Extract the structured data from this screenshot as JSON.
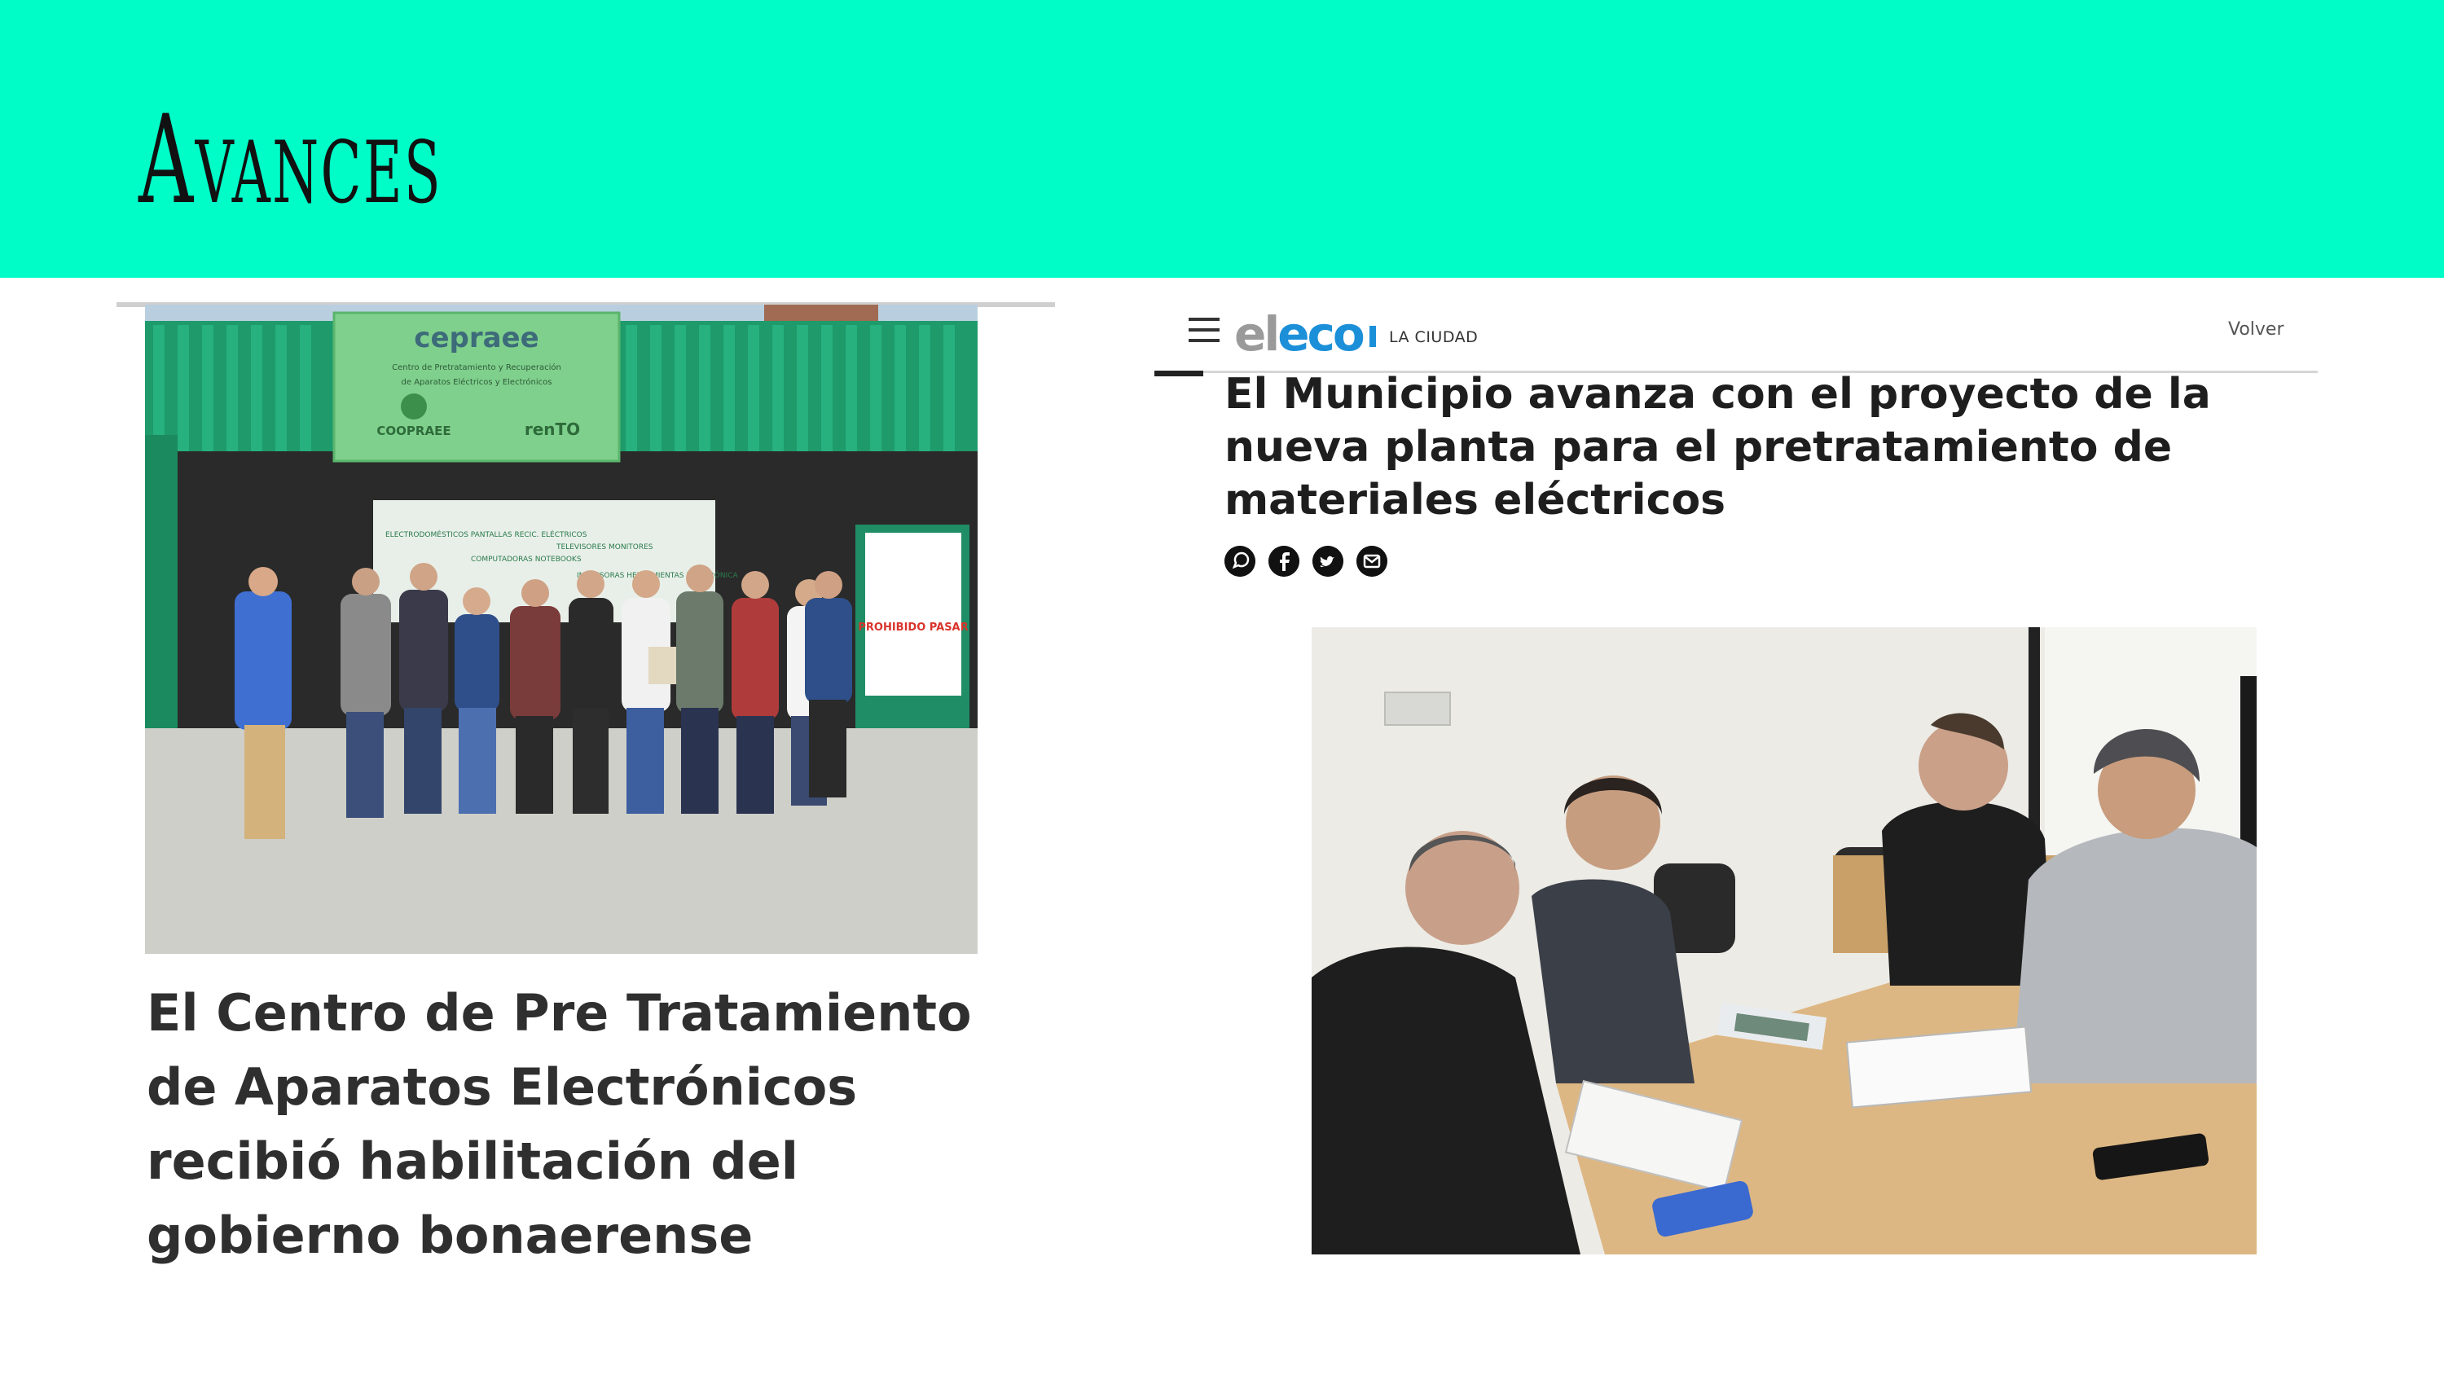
{
  "slide": {
    "title": "Avances",
    "banner_color": "#00fdc8"
  },
  "left_article": {
    "headline": "El Centro de Pre Tratamiento de Aparatos Electrónicos recibió habilitación del gobierno bonaerense",
    "photo": {
      "sign_brand": "cepraee",
      "sign_line_1": "Centro de Pretratamiento y Recuperación",
      "sign_line_2": "de Aparatos Eléctricos y Electrónicos",
      "sign_logo_left": "COOPRAEE",
      "sign_logo_right": "renTO",
      "banner_columns": [
        "ELECTRODOMÉSTICOS PANTALLAS RECIC. ELÉCTRICOS",
        "COMPUTADORAS NOTEBOOKS",
        "TELEVISORES MONITORES",
        "IMPRESORAS HERRAMIENTAS ELECTRÓNICA"
      ],
      "door_sign": "PROHIBIDO PASAR"
    }
  },
  "right_article": {
    "site": {
      "logo_el": "el",
      "logo_eco": "eco",
      "section": "LA CIUDAD",
      "back_label": "Volver",
      "brand_color": "#1c8fd9"
    },
    "headline": "El Municipio avanza con el proyecto de la nueva planta para el pretratamiento de materiales eléctricos",
    "share_icons": [
      "whatsapp-icon",
      "facebook-icon",
      "twitter-icon",
      "email-icon"
    ]
  }
}
